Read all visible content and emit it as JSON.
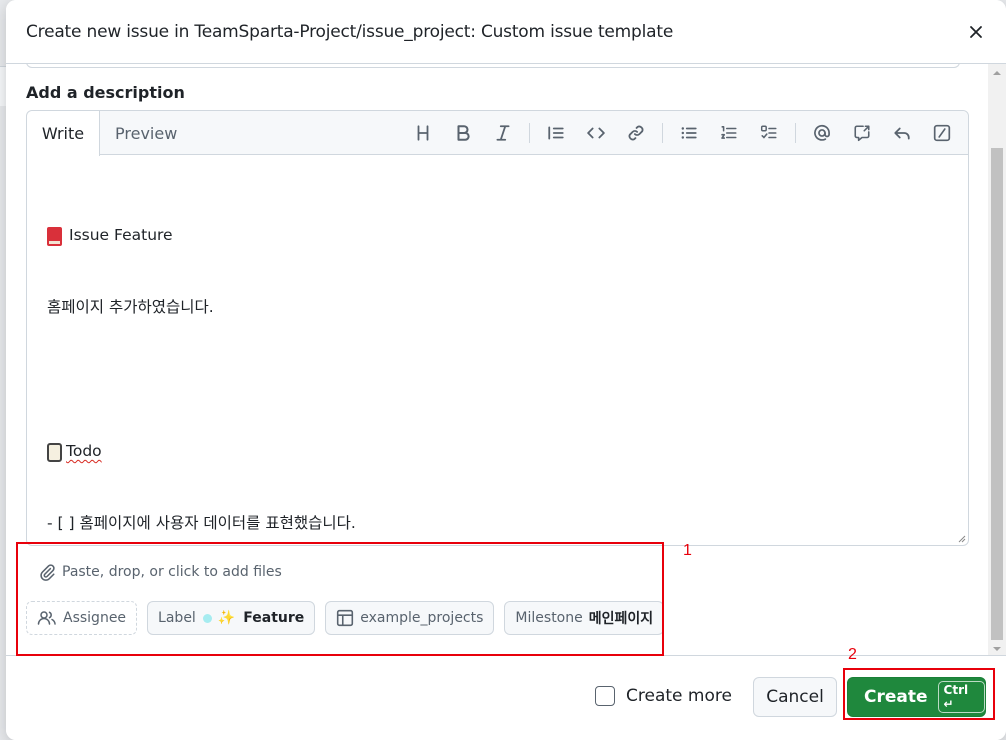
{
  "dialog": {
    "title": "Create new issue in TeamSparta-Project/issue_project: Custom issue template"
  },
  "description": {
    "label": "Add a description"
  },
  "editor": {
    "tabs": [
      {
        "label": "Write",
        "active": true
      },
      {
        "label": "Preview",
        "active": false
      }
    ],
    "toolbar": [
      "heading-icon",
      "bold-icon",
      "italic-icon",
      "quote-icon",
      "code-icon",
      "link-icon",
      "unordered-list-icon",
      "ordered-list-icon",
      "task-list-icon",
      "mention-icon",
      "reference-icon",
      "undo-icon",
      "slash-commands-icon"
    ],
    "lines": [
      "Issue Feature",
      "홈페이지 추가하였습니다.",
      "",
      "Todo",
      "- [ ] 홈페이지에 사용자 데이터를 표현했습니다."
    ]
  },
  "attachments": {
    "label": "Paste, drop, or click to add files"
  },
  "metadata": {
    "assignee": "Assignee",
    "label_title": "Label",
    "label_value": "Feature",
    "label_color": "#a6ecf0",
    "project": "example_projects",
    "milestone_title": "Milestone",
    "milestone_value": "메인페이지"
  },
  "footer": {
    "create_more_label": "Create more",
    "create_more_checked": false,
    "cancel_label": "Cancel",
    "create_label": "Create",
    "create_shortcut": "Ctrl ↵"
  },
  "annotations": {
    "box1": "1",
    "box2": "2",
    "color": "#e8000b"
  },
  "colors": {
    "primary_button": "#1f883d",
    "border": "#d0d7de",
    "muted_text": "#59636e"
  }
}
